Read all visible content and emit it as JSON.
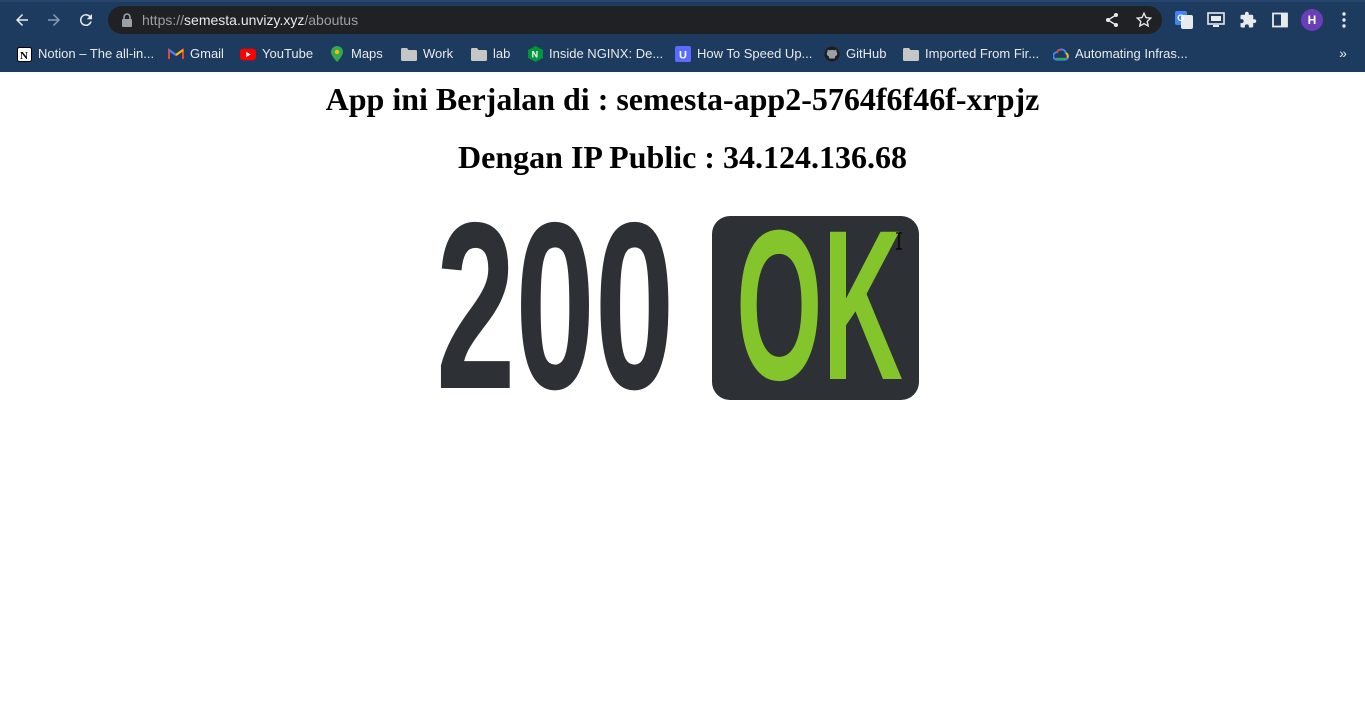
{
  "browser": {
    "url": {
      "scheme": "https://",
      "host": "semesta.unvizy.xyz",
      "path": "/aboutus"
    },
    "profile_initial": "H",
    "toolbar_icons": [
      "back-icon",
      "forward-icon",
      "reload-icon",
      "lock-icon",
      "share-icon",
      "star-icon",
      "google-translate-icon",
      "cast-icon",
      "extensions-icon",
      "side-panel-icon",
      "menu-icon"
    ],
    "bookmarks": [
      {
        "label": "Notion – The all-in...",
        "icon": "notion-icon"
      },
      {
        "label": "Gmail",
        "icon": "gmail-icon"
      },
      {
        "label": "YouTube",
        "icon": "youtube-icon"
      },
      {
        "label": "Maps",
        "icon": "maps-icon"
      },
      {
        "label": "Work",
        "icon": "folder-icon"
      },
      {
        "label": "lab",
        "icon": "folder-icon"
      },
      {
        "label": "Inside NGINX: De...",
        "icon": "nginx-icon"
      },
      {
        "label": "How To Speed Up...",
        "icon": "u-icon"
      },
      {
        "label": "GitHub",
        "icon": "github-icon"
      },
      {
        "label": "Imported From Fir...",
        "icon": "folder-icon"
      },
      {
        "label": "Automating Infras...",
        "icon": "gcloud-icon"
      }
    ],
    "more_bookmarks": "»"
  },
  "page": {
    "app_heading": "App ini Berjalan di : semesta-app2-5764f6f46f-xrpjz",
    "ip_heading": "Dengan IP Public : 34.124.136.68",
    "status_code": "200",
    "status_text": "OK",
    "colors": {
      "status_dark": "#2d3035",
      "status_ok_green": "#84c52b",
      "chrome_bg": "#1d3a5f",
      "omnibox_bg": "#202124"
    }
  }
}
